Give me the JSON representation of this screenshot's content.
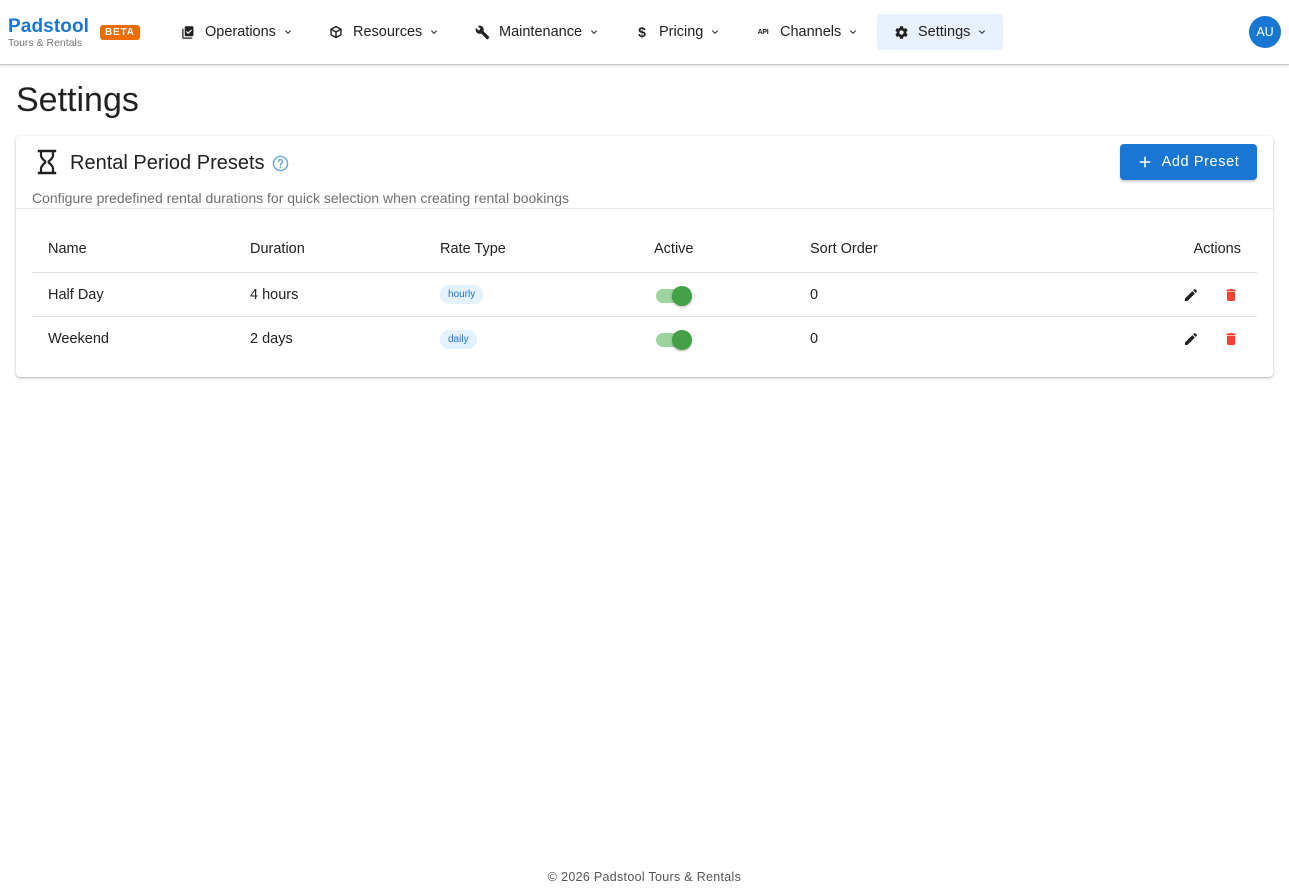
{
  "app": {
    "brand": "Padstool",
    "subtitle": "Tours & Rentals",
    "badge": "BETA",
    "user_initials": "AU"
  },
  "nav": [
    {
      "label": "Operations",
      "icon": "clipboard-check-icon"
    },
    {
      "label": "Resources",
      "icon": "cube-icon"
    },
    {
      "label": "Maintenance",
      "icon": "wrench-icon"
    },
    {
      "label": "Pricing",
      "icon": "dollar-icon"
    },
    {
      "label": "Channels",
      "icon": "api-icon"
    },
    {
      "label": "Settings",
      "icon": "gear-icon",
      "active": true
    }
  ],
  "page": {
    "title": "Settings"
  },
  "card": {
    "title": "Rental Period Presets",
    "subtitle": "Configure predefined rental durations for quick selection when creating rental bookings",
    "add_button": "Add Preset"
  },
  "table": {
    "headers": {
      "name": "Name",
      "duration": "Duration",
      "rate_type": "Rate Type",
      "active": "Active",
      "sort_order": "Sort Order",
      "actions": "Actions"
    },
    "rows": [
      {
        "name": "Half Day",
        "duration": "4 hours",
        "rate_type": "hourly",
        "active": true,
        "sort_order": "0"
      },
      {
        "name": "Weekend",
        "duration": "2 days",
        "rate_type": "daily",
        "active": true,
        "sort_order": "0"
      }
    ]
  },
  "footer": "© 2026 Padstool Tours & Rentals",
  "colors": {
    "primary": "#1976d2",
    "beta_badge": "#ef6c00",
    "switch_on": "#43a047",
    "delete": "#f44336"
  }
}
